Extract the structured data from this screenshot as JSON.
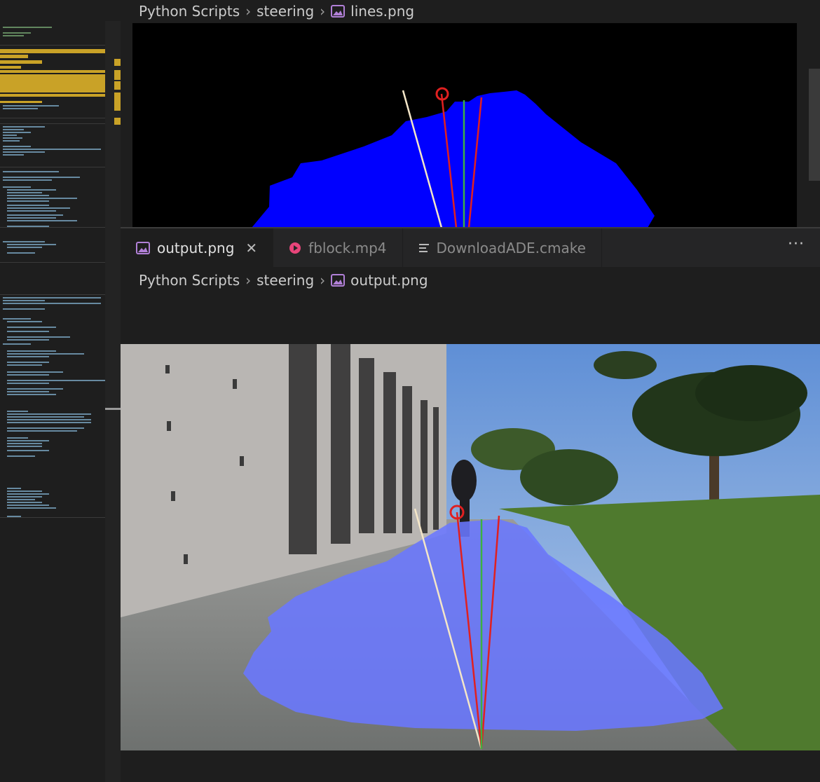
{
  "colors": {
    "background": "#1e1e1e",
    "tabbar": "#252526",
    "mask_blue": "#0000ff",
    "overlay_blue": "#6a78ff",
    "line_red": "#e02020",
    "line_green": "#3cb043",
    "line_white": "#f4e6c8",
    "image_icon": "#b180d7",
    "video_icon": "#e8457a"
  },
  "top_editor": {
    "breadcrumb": {
      "folder": "Python Scripts",
      "subfolder": "steering",
      "file": "lines.png"
    }
  },
  "tabs": [
    {
      "label": "output.png",
      "icon": "image-file-icon",
      "active": true,
      "closable": true
    },
    {
      "label": "fblock.mp4",
      "icon": "video-file-icon",
      "active": false,
      "closable": false
    },
    {
      "label": "DownloadADE.cmake",
      "icon": "text-file-icon",
      "active": false,
      "closable": false
    }
  ],
  "tab_overflow": {
    "label": "···",
    "icon": "more-actions-icon"
  },
  "bottom_editor": {
    "breadcrumb": {
      "folder": "Python Scripts",
      "subfolder": "steering",
      "file": "output.png"
    }
  }
}
